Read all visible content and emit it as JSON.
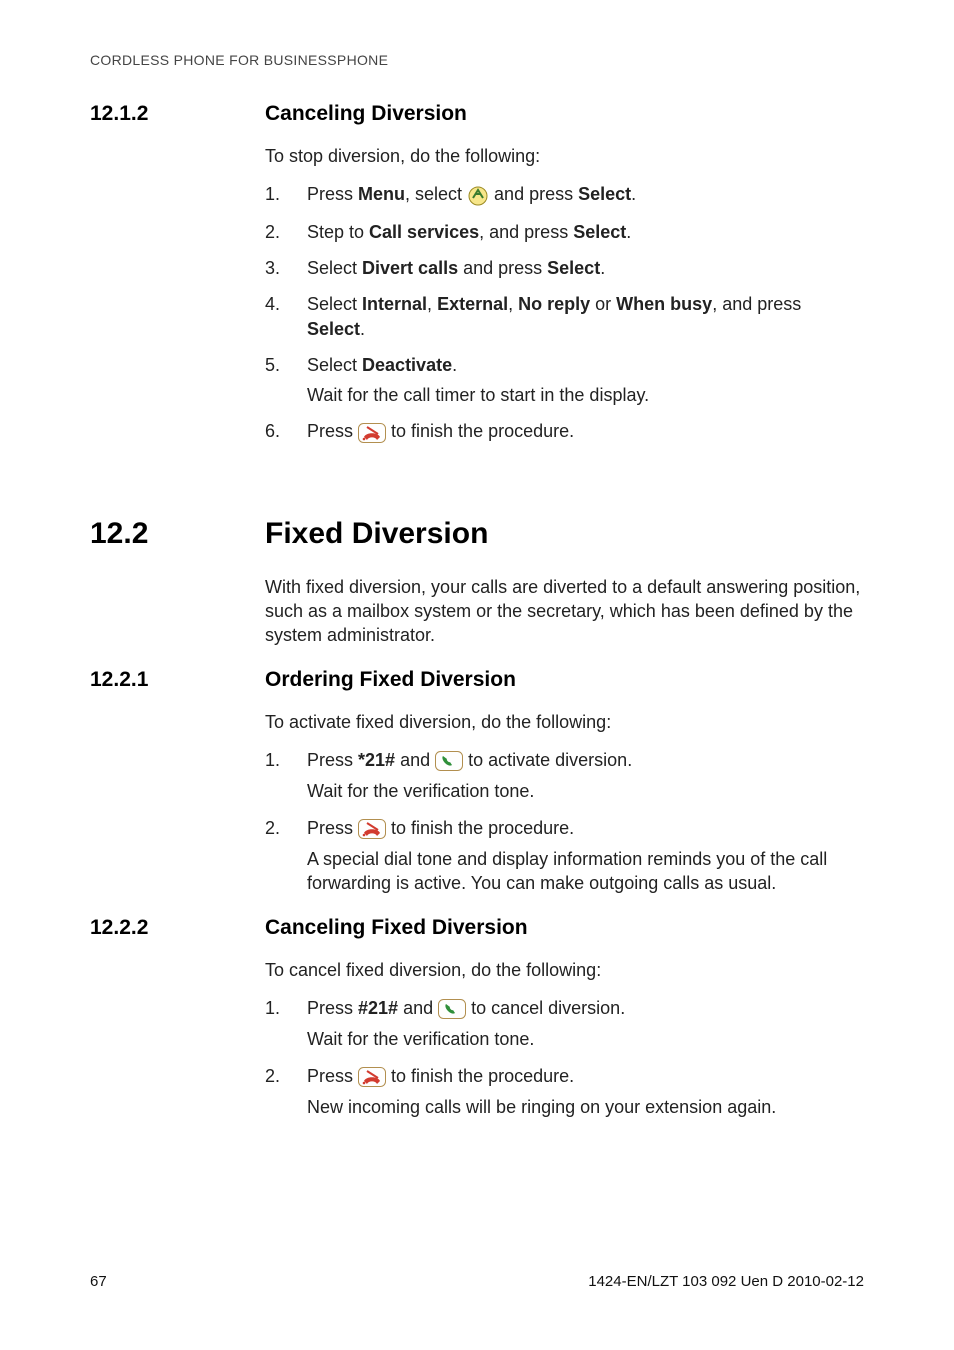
{
  "running_header": "CORDLESS PHONE FOR BUSINESSPHONE",
  "s12_1_2": {
    "num": "12.1.2",
    "title": "Canceling Diversion",
    "intro": "To stop diversion, do the following:",
    "steps": {
      "n1": "1.",
      "s1_a": "Press ",
      "s1_b": "Menu",
      "s1_c": ", select ",
      "s1_d": " and press ",
      "s1_e": "Select",
      "s1_f": ".",
      "n2": "2.",
      "s2_a": "Step to ",
      "s2_b": "Call services",
      "s2_c": ", and press ",
      "s2_d": "Select",
      "s2_e": ".",
      "n3": "3.",
      "s3_a": "Select ",
      "s3_b": "Divert calls",
      "s3_c": " and press ",
      "s3_d": "Select",
      "s3_e": ".",
      "n4": "4.",
      "s4_a": "Select ",
      "s4_b": "Internal",
      "s4_c": ", ",
      "s4_d": "External",
      "s4_e": ", ",
      "s4_f": "No reply",
      "s4_g": " or ",
      "s4_h": "When busy",
      "s4_i": ", and press ",
      "s4_j": "Select",
      "s4_k": ".",
      "n5": "5.",
      "s5_a": "Select ",
      "s5_b": "Deactivate",
      "s5_c": ".",
      "s5_sub": "Wait for the call timer to start in the display.",
      "n6": "6.",
      "s6_a": "Press ",
      "s6_b": " to finish the procedure."
    }
  },
  "s12_2": {
    "num": "12.2",
    "title": "Fixed Diversion",
    "para": "With fixed diversion, your calls are diverted to a default answering position, such as a mailbox system or the secretary, which has been defined by the system administrator."
  },
  "s12_2_1": {
    "num": "12.2.1",
    "title": "Ordering Fixed Diversion",
    "intro": "To activate fixed diversion, do the following:",
    "steps": {
      "n1": "1.",
      "s1_a": "Press ",
      "s1_b": "*21#",
      "s1_c": " and ",
      "s1_d": " to activate diversion.",
      "s1_sub": "Wait for the verification tone.",
      "n2": "2.",
      "s2_a": "Press ",
      "s2_b": " to finish the procedure.",
      "s2_sub": "A special dial tone and display information reminds you of the call forwarding is active. You can make outgoing calls as usual."
    }
  },
  "s12_2_2": {
    "num": "12.2.2",
    "title": "Canceling Fixed Diversion",
    "intro": "To cancel fixed diversion, do the following:",
    "steps": {
      "n1": "1.",
      "s1_a": "Press ",
      "s1_b": "#21#",
      "s1_c": " and ",
      "s1_d": " to cancel diversion.",
      "s1_sub": "Wait for the verification tone.",
      "n2": "2.",
      "s2_a": "Press ",
      "s2_b": " to finish the procedure.",
      "s2_sub": "New incoming calls will be ringing on your extension again."
    }
  },
  "footer": {
    "page": "67",
    "doc_id": "1424-EN/LZT 103 092 Uen D 2010-02-12"
  }
}
